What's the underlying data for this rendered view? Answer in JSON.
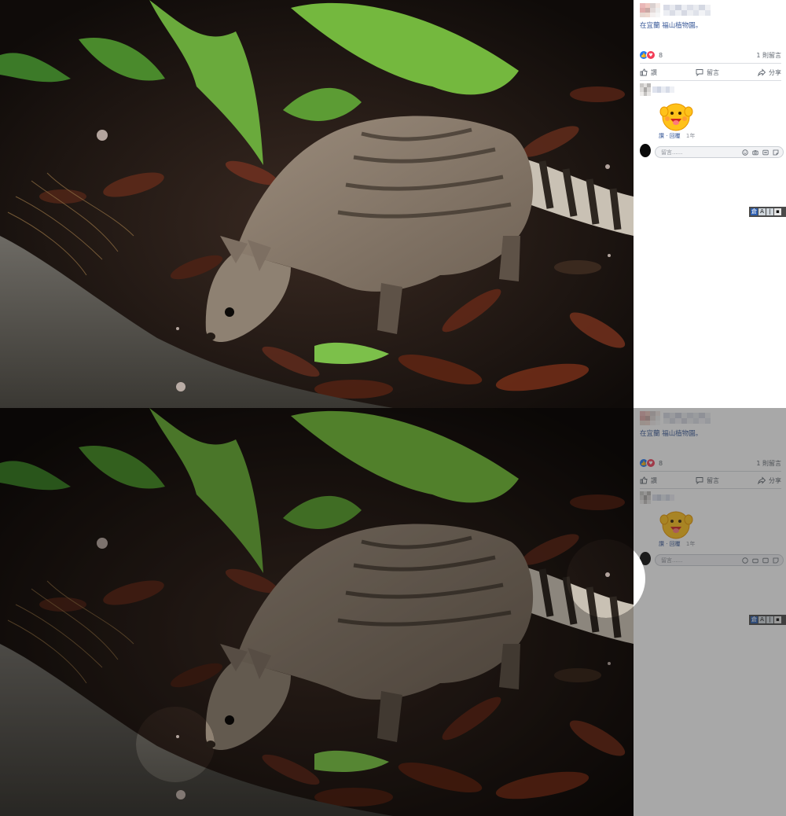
{
  "post": {
    "location_text": "在宜蘭 福山植物園。",
    "reactions": {
      "count": "8",
      "like_glyph": "👍",
      "love_glyph": "♥"
    },
    "comments_count_text": "1 則留言",
    "actions": {
      "like": "讚",
      "comment": "留言",
      "share": "分享"
    }
  },
  "comment": {
    "sticker": "yellow-blob-sticker",
    "meta": {
      "like": "讚",
      "reply": "回覆",
      "age": "1年"
    }
  },
  "reply_box": {
    "placeholder": "留言......"
  },
  "ime_indicator": {
    "keys": [
      "倉",
      "A",
      "|",
      "▪"
    ]
  },
  "colors": {
    "link": "#385898",
    "like_blue": "#2078f4",
    "love_red": "#f33e58",
    "sidebar_bg": "#ffffff",
    "divider": "#dadde1"
  },
  "icons": {
    "like": "thumbs-up-icon",
    "comment": "speech-bubble-icon",
    "share": "share-arrow-icon",
    "reply_tools": [
      "emoji-icon",
      "camera-icon",
      "gif-icon",
      "sticker-icon"
    ]
  }
}
